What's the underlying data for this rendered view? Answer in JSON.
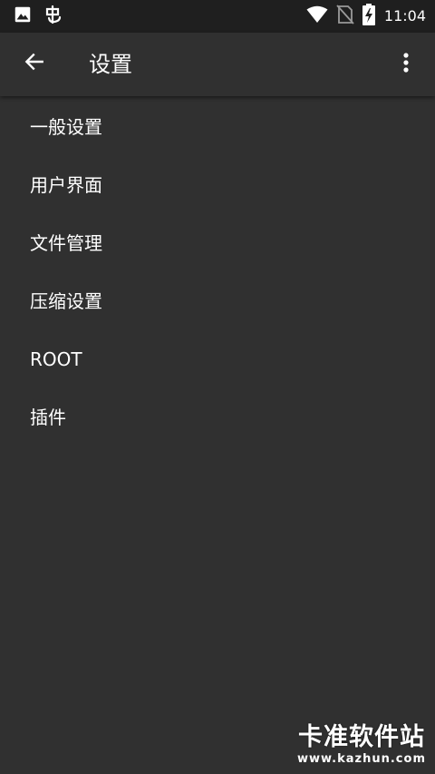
{
  "status_bar": {
    "time": "11:04",
    "icons": [
      "image-icon",
      "bug-icon",
      "wifi-icon",
      "no-sim-icon",
      "battery-charging-icon"
    ]
  },
  "app_bar": {
    "title": "设置",
    "back_icon": "arrow-back-icon",
    "menu_icon": "more-vert-icon"
  },
  "settings": {
    "items": [
      {
        "label": "一般设置"
      },
      {
        "label": "用户界面"
      },
      {
        "label": "文件管理"
      },
      {
        "label": "压缩设置"
      },
      {
        "label": "ROOT"
      },
      {
        "label": "插件"
      }
    ]
  },
  "watermark": {
    "name": "卡准软件站",
    "url": "www.kazhun.com"
  },
  "colors": {
    "background": "#303030",
    "status_bar": "#1f1f1f",
    "text": "#ffffff"
  }
}
